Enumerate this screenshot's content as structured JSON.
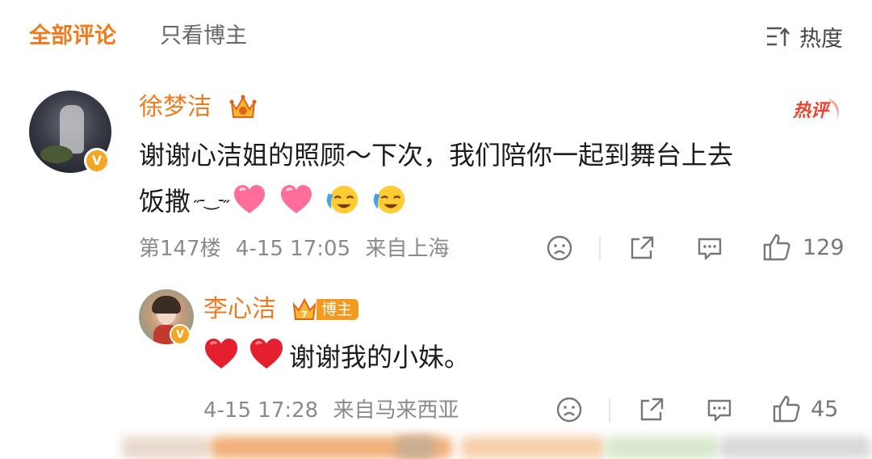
{
  "tabs": {
    "all_comments": "全部评论",
    "author_only": "只看博主",
    "sort_label": "热度"
  },
  "comment": {
    "username": "徐梦洁",
    "hot_badge": "热评",
    "text_line1": "谢谢心洁姐的照顾～下次，我们陪你一起到舞台上去",
    "text_line2_word": "饭撒",
    "kaomoji": "˶-‿-˶",
    "emojis": [
      "heart-pink-icon",
      "heart-pink-icon",
      "tears-of-joy-icon",
      "tears-of-joy-icon"
    ],
    "floor": "第147楼",
    "time": "4-15 17:05",
    "location": "来自上海",
    "like_count": "129",
    "colors": {
      "name": "#f07a1c",
      "hot": "#e8432f"
    }
  },
  "reply": {
    "username": "李心洁",
    "blogger_tag": "博主",
    "level": "7",
    "text": "谢谢我的小妹。",
    "emojis": [
      "red-heart-icon",
      "red-heart-icon"
    ],
    "time": "4-15 17:28",
    "location": "来自马来西亚",
    "like_count": "45"
  }
}
